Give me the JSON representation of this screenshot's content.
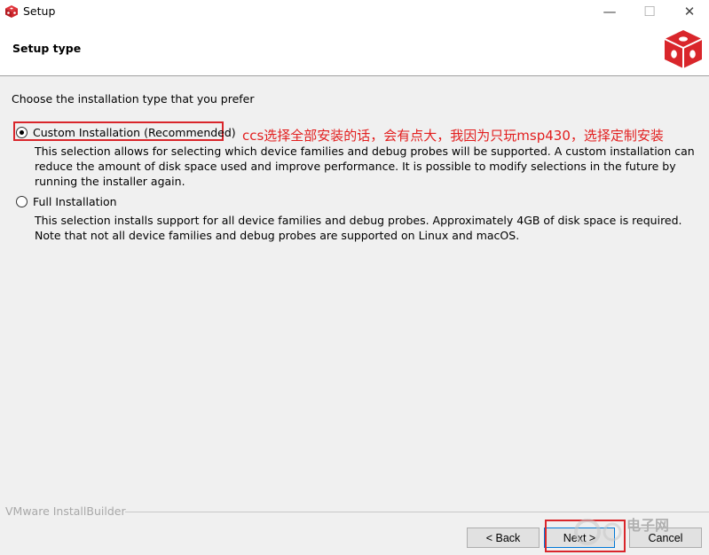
{
  "window": {
    "title": "Setup",
    "minimize_icon": "minimize-icon",
    "maximize_icon": "maximize-icon",
    "close_icon": "close-icon"
  },
  "header": {
    "title": "Setup type",
    "logo_icon": "vmware-installbuilder-cube-logo"
  },
  "main": {
    "prompt": "Choose the installation type that you prefer",
    "options": [
      {
        "label": "Custom Installation (Recommended)",
        "selected": true,
        "description": "This selection allows for selecting which device families and debug probes will be supported.  A custom installation can reduce the amount of disk space used and improve performance.  It is possible to modify selections in the future by running the installer again."
      },
      {
        "label": "Full Installation",
        "selected": false,
        "description": "This selection installs support for all device families and debug probes.  Approximately 4GB of disk space is required.  Note that not all device families and debug probes are supported on Linux and macOS."
      }
    ],
    "annotation": "ccs选择全部安装的话，会有点大，我因为只玩msp430，选择定制安装"
  },
  "footer": {
    "brand": "VMware InstallBuilder",
    "back_label": "< Back",
    "next_label": "Next >",
    "cancel_label": "Cancel",
    "watermark_text": "电子网"
  },
  "colors": {
    "highlight": "#d9262b",
    "logo": "#d9262b",
    "annotation": "#e21f1f"
  }
}
